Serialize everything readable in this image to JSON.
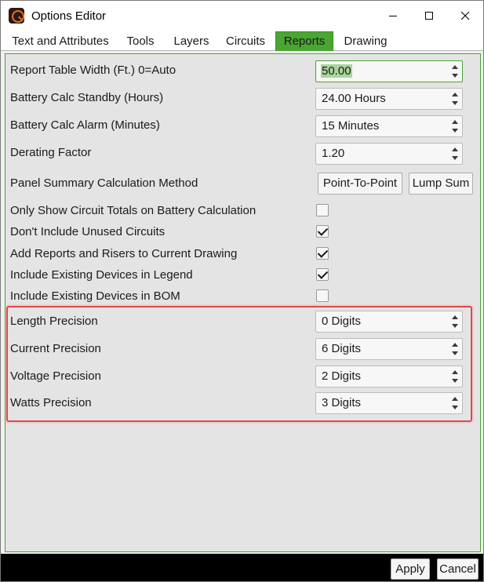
{
  "window": {
    "title": "Options Editor"
  },
  "tabs": [
    {
      "label": "Text and Attributes",
      "active": false
    },
    {
      "label": "Tools",
      "active": false
    },
    {
      "label": "Layers",
      "active": false
    },
    {
      "label": "Circuits",
      "active": false
    },
    {
      "label": "Reports",
      "active": true
    },
    {
      "label": "Drawing",
      "active": false
    }
  ],
  "reports": {
    "table_width": {
      "label": "Report Table Width (Ft.) 0=Auto",
      "value": "50.00"
    },
    "battery_standby": {
      "label": "Battery Calc Standby (Hours)",
      "value": "24.00 Hours"
    },
    "battery_alarm": {
      "label": "Battery Calc Alarm (Minutes)",
      "value": "15 Minutes"
    },
    "derating_factor": {
      "label": "Derating Factor",
      "value": "1.20"
    },
    "panel_summary": {
      "label": "Panel Summary Calculation Method",
      "point_to_point": "Point-To-Point",
      "lump_sum": "Lump Sum"
    },
    "checkboxes": [
      {
        "label": "Only Show Circuit Totals on Battery Calculation",
        "checked": false
      },
      {
        "label": "Don't Include Unused Circuits",
        "checked": true
      },
      {
        "label": "Add Reports and Risers to Current Drawing",
        "checked": true
      },
      {
        "label": "Include Existing Devices in Legend",
        "checked": true
      },
      {
        "label": "Include Existing Devices in BOM",
        "checked": false
      }
    ],
    "precision": {
      "length": {
        "label": "Length Precision",
        "value": "0 Digits"
      },
      "current": {
        "label": "Current Precision",
        "value": "6 Digits"
      },
      "voltage": {
        "label": "Voltage Precision",
        "value": "2 Digits"
      },
      "watts": {
        "label": "Watts Precision",
        "value": "3 Digits"
      }
    }
  },
  "footer": {
    "apply": "Apply",
    "cancel": "Cancel"
  },
  "colors": {
    "accent": "#4aa532",
    "highlight_border": "#e0474c",
    "selection": "#a7d59b"
  },
  "icons": {
    "app": "app-logo-icon",
    "minimize": "minimize-icon",
    "maximize": "maximize-icon",
    "close": "close-icon"
  }
}
